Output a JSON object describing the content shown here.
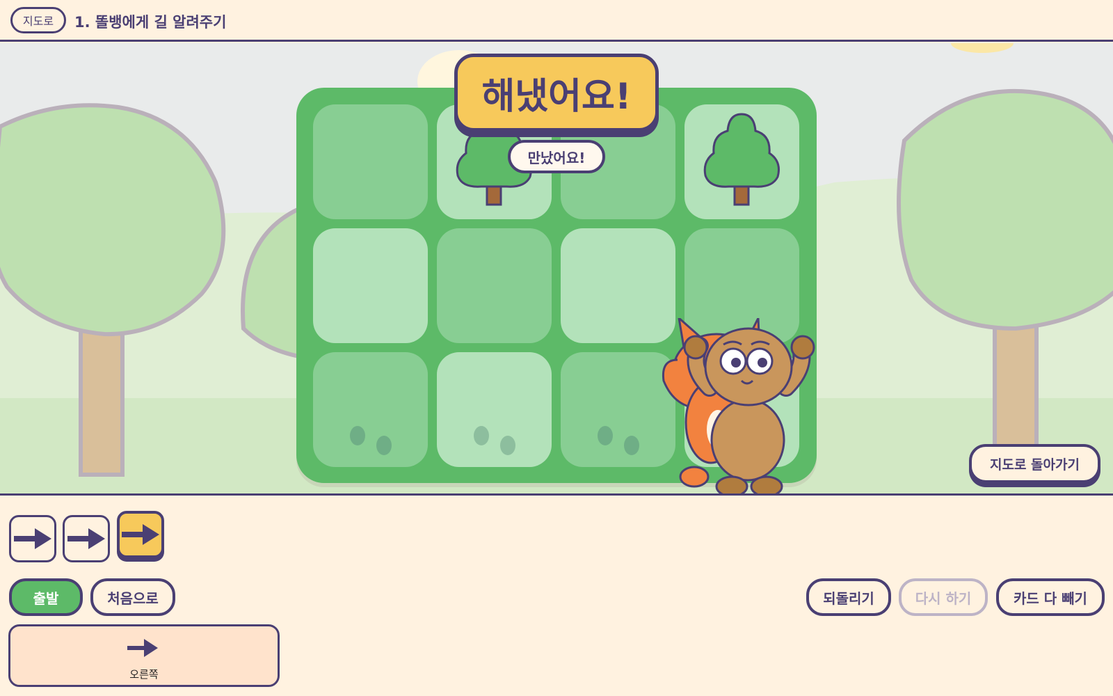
{
  "header": {
    "map_label": "지도로",
    "title": "1. 똘뱅에게 길 알려주기"
  },
  "scene": {
    "banner_text": "해냈어요!",
    "speech_text": "만났어요!",
    "back_to_map_label": "지도로 돌아가기",
    "grid": {
      "rows": 3,
      "cols": 4,
      "tiles": [
        {
          "shade": "dark",
          "content": ""
        },
        {
          "shade": "light",
          "content": "tree"
        },
        {
          "shade": "dark",
          "content": ""
        },
        {
          "shade": "light",
          "content": "tree"
        },
        {
          "shade": "light",
          "content": ""
        },
        {
          "shade": "dark",
          "content": ""
        },
        {
          "shade": "light",
          "content": ""
        },
        {
          "shade": "dark",
          "content": ""
        },
        {
          "shade": "dark",
          "content": "footprints"
        },
        {
          "shade": "light",
          "content": "footprints"
        },
        {
          "shade": "dark",
          "content": "footprints"
        },
        {
          "shade": "light",
          "content": "characters"
        }
      ]
    }
  },
  "program": {
    "cards": [
      {
        "icon": "arrow-right-icon",
        "active": false
      },
      {
        "icon": "arrow-right-icon",
        "active": false
      },
      {
        "icon": "arrow-right-icon",
        "active": true
      }
    ]
  },
  "controls": {
    "start_label": "출발",
    "reset_label": "처음으로",
    "undo_label": "되돌리기",
    "redo_label": "다시 하기",
    "clear_label": "카드 다 빼기"
  },
  "palette": {
    "items": [
      {
        "icon": "arrow-right-icon",
        "label": "오른쪽"
      }
    ]
  },
  "colors": {
    "ink": "#4A3F73",
    "cream": "#FFF2E0",
    "board_green": "#5DBA68",
    "tile_light": "#B3E2BA",
    "tile_dark": "#88CE93",
    "banner_yellow": "#F7C95B",
    "start_green": "#5DBA68",
    "disabled": "#BDB3C6"
  }
}
